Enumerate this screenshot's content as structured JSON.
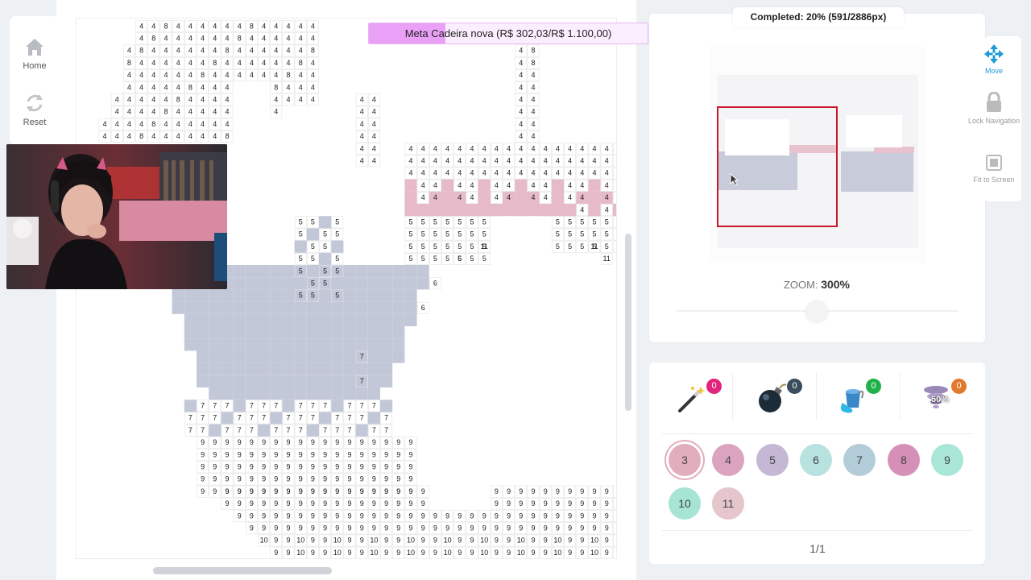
{
  "nav": {
    "home_label": "Home",
    "reset_label": "Reset"
  },
  "goal": {
    "text": "Meta Cadeira nova (R$ 302,03/R$ 1.100,00)",
    "progress": 0.2746,
    "color": "#eaa0f6"
  },
  "completed": {
    "text": "Completed: 20% (591/2886px)",
    "percent": 20
  },
  "zoom": {
    "label": "ZOOM:",
    "value": "300%"
  },
  "right_tools": [
    {
      "name": "move",
      "label": "Move",
      "icon": "move-arrows-icon",
      "active": true
    },
    {
      "name": "lock-navigation",
      "label": "Lock Navigation",
      "icon": "lock-icon",
      "active": false
    },
    {
      "name": "fit-to-screen",
      "label": "Fit to Screen",
      "icon": "fit-screen-icon",
      "active": false
    }
  ],
  "boosters": [
    {
      "name": "magic-wand",
      "icon": "magic-wand-icon",
      "count": "0",
      "badge_color": "#e2247d"
    },
    {
      "name": "bomb",
      "icon": "bomb-icon",
      "count": "0",
      "badge_color": "#3b4d5c"
    },
    {
      "name": "paint-bucket",
      "icon": "paint-bucket-icon",
      "count": "0",
      "badge_color": "#21b14a"
    },
    {
      "name": "tornado",
      "icon": "tornado-icon",
      "count": "0",
      "badge_color": "#e07a2e",
      "overlay": "50%"
    }
  ],
  "palette": [
    {
      "num": "3",
      "color": "#e2aebb",
      "selected": true
    },
    {
      "num": "4",
      "color": "#dba3c0"
    },
    {
      "num": "5",
      "color": "#c4b8d4"
    },
    {
      "num": "6",
      "color": "#b7e2df"
    },
    {
      "num": "7",
      "color": "#b3cdd8"
    },
    {
      "num": "8",
      "color": "#d490b6"
    },
    {
      "num": "9",
      "color": "#a9e6d8"
    },
    {
      "num": "10",
      "color": "#a6e5d4"
    },
    {
      "num": "11",
      "color": "#e4c6cc"
    }
  ],
  "page": "1/1",
  "colors": {
    "filled_blue": "#c3c8d8",
    "filled_pink": "#e6bac8",
    "minimap_border": "#c8162c"
  }
}
